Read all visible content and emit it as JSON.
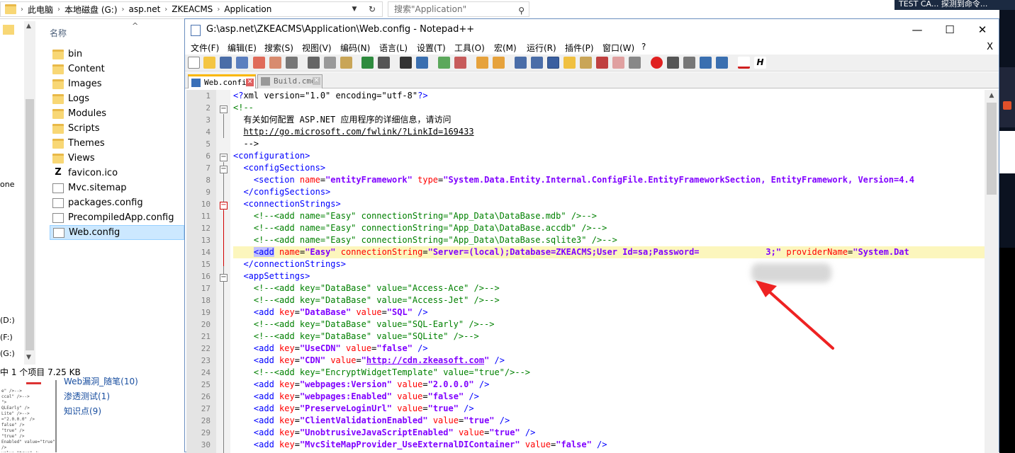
{
  "explorer": {
    "breadcrumb": [
      "此电脑",
      "本地磁盘 (G:)",
      "asp.net",
      "ZKEACMS",
      "Application"
    ],
    "search_placeholder": "搜索\"Application\"",
    "column_header": "名称",
    "files": [
      {
        "name": "bin",
        "type": "folder"
      },
      {
        "name": "Content",
        "type": "folder"
      },
      {
        "name": "Images",
        "type": "folder"
      },
      {
        "name": "Logs",
        "type": "folder"
      },
      {
        "name": "Modules",
        "type": "folder"
      },
      {
        "name": "Scripts",
        "type": "folder"
      },
      {
        "name": "Themes",
        "type": "folder"
      },
      {
        "name": "Views",
        "type": "folder"
      },
      {
        "name": "favicon.ico",
        "type": "ico"
      },
      {
        "name": "Mvc.sitemap",
        "type": "file"
      },
      {
        "name": "packages.config",
        "type": "file"
      },
      {
        "name": "PrecompiledApp.config",
        "type": "file"
      },
      {
        "name": "Web.config",
        "type": "file",
        "selected": true
      }
    ],
    "nav_labels": {
      "one": "one",
      "d": "(D:)",
      "f": "(F:)",
      "g": "(G:)"
    },
    "status": "中 1 个项目  7.25 KB"
  },
  "blog": {
    "links": [
      "Web漏洞_随笔(10)",
      "渗透测试(1)",
      "知识点(9)"
    ]
  },
  "taskbar": {
    "top_right": "TEST CA...   探测到命令..."
  },
  "notepad": {
    "title": "G:\\asp.net\\ZKEACMS\\Application\\Web.config - Notepad++",
    "window_buttons": {
      "minimize": "—",
      "maximize": "☐",
      "close": "✕"
    },
    "menus": [
      "文件(F)",
      "编辑(E)",
      "搜索(S)",
      "视图(V)",
      "编码(N)",
      "语言(L)",
      "设置(T)",
      "工具(O)",
      "宏(M)",
      "运行(R)",
      "插件(P)",
      "窗口(W)",
      "?"
    ],
    "close_doc": "X",
    "tabs": [
      {
        "label": "Web.config",
        "active": true
      },
      {
        "label": "Build.cmd",
        "active": false
      }
    ],
    "line_numbers": [
      "1",
      "2",
      "3",
      "4",
      "5",
      "6",
      "7",
      "8",
      "9",
      "10",
      "11",
      "12",
      "13",
      "14",
      "15",
      "16",
      "17",
      "18",
      "19",
      "20",
      "21",
      "22",
      "23",
      "24",
      "25",
      "26",
      "27",
      "28",
      "29",
      "30"
    ]
  },
  "colors": {
    "accent": "#fab700",
    "highlight": "#fcf6bd",
    "arrow": "#ee2222"
  }
}
